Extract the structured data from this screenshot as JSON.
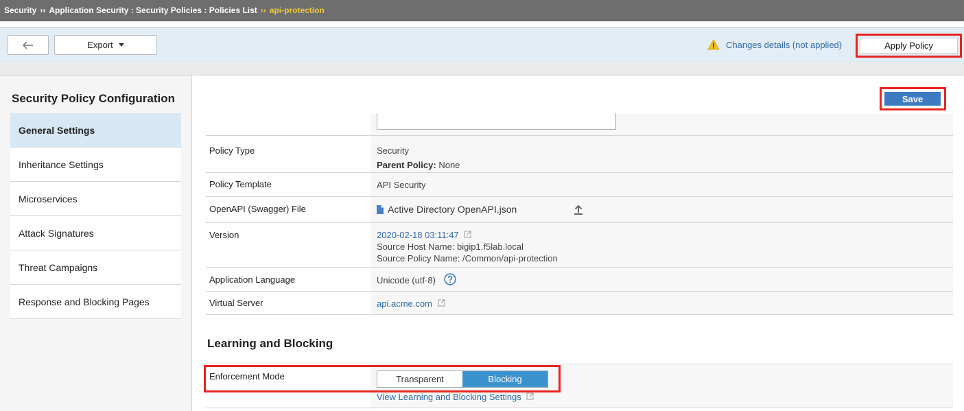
{
  "breadcrumb": {
    "items": [
      "Security",
      "Application Security : Security Policies : Policies List"
    ],
    "separator": "››",
    "current": "api-protection"
  },
  "toolbar": {
    "back_icon": "arrow-left-icon",
    "export_label": "Export",
    "changes_label": "Changes details (not applied)",
    "apply_label": "Apply Policy"
  },
  "sidebar": {
    "title": "Security Policy Configuration",
    "items": [
      {
        "label": "General Settings",
        "active": true
      },
      {
        "label": "Inheritance Settings"
      },
      {
        "label": "Microservices"
      },
      {
        "label": "Attack Signatures"
      },
      {
        "label": "Threat Campaigns"
      },
      {
        "label": "Response and Blocking Pages"
      }
    ]
  },
  "main": {
    "save_label": "Save",
    "policy_type": {
      "label": "Policy Type",
      "value": "Security",
      "parent_label": "Parent Policy:",
      "parent_value": "None"
    },
    "policy_template": {
      "label": "Policy Template",
      "value": "API Security"
    },
    "openapi": {
      "label": "OpenAPI (Swagger) File",
      "value": "Active Directory OpenAPI.json"
    },
    "version": {
      "label": "Version",
      "date": "2020-02-18 03:11:47",
      "host": "Source Host Name: bigip1.f5lab.local",
      "policy": "Source Policy Name: /Common/api-protection"
    },
    "language": {
      "label": "Application Language",
      "value": "Unicode (utf-8)"
    },
    "virtual_server": {
      "label": "Virtual Server",
      "value": "api.acme.com"
    },
    "learning_title": "Learning and Blocking",
    "enforcement": {
      "label": "Enforcement Mode",
      "option_transparent": "Transparent",
      "option_blocking": "Blocking",
      "selected": "Blocking",
      "link": "View Learning and Blocking Settings"
    }
  },
  "colors": {
    "accent": "#3d7cc0",
    "highlight": "#e8231d",
    "crumb_current": "#f3c53c",
    "link": "#2f6aa8"
  }
}
